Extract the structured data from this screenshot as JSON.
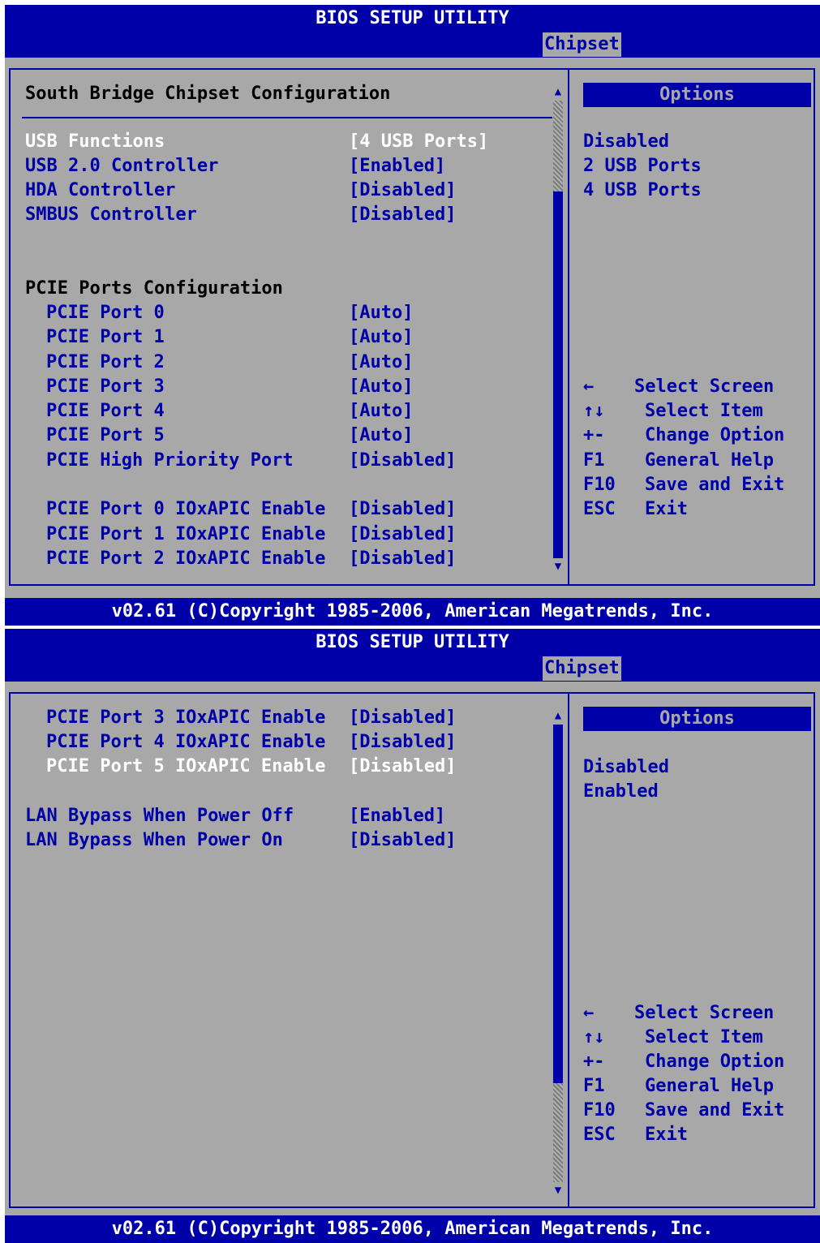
{
  "title": "BIOS SETUP UTILITY",
  "active_tab": "Chipset",
  "footer": "v02.61 (C)Copyright 1985-2006, American Megatrends, Inc.",
  "screen1": {
    "heading": "South Bridge Chipset Configuration",
    "items": [
      {
        "label": "USB Functions",
        "value": "[4 USB Ports]"
      },
      {
        "label": "USB 2.0 Controller",
        "value": "[Enabled]"
      },
      {
        "label": "HDA Controller",
        "value": "[Disabled]"
      },
      {
        "label": "SMBUS Controller",
        "value": "[Disabled]"
      }
    ],
    "pcie_heading": "PCIE Ports Configuration",
    "pcie_items": [
      {
        "label": "PCIE Port 0",
        "value": "[Auto]"
      },
      {
        "label": "PCIE Port 1",
        "value": "[Auto]"
      },
      {
        "label": "PCIE Port 2",
        "value": "[Auto]"
      },
      {
        "label": "PCIE Port 3",
        "value": "[Auto]"
      },
      {
        "label": "PCIE Port 4",
        "value": "[Auto]"
      },
      {
        "label": "PCIE Port 5",
        "value": "[Auto]"
      },
      {
        "label": "PCIE High Priority Port",
        "value": "[Disabled]"
      }
    ],
    "ioapic_items": [
      {
        "label": "PCIE Port 0 IOxAPIC Enable",
        "value": "[Disabled]"
      },
      {
        "label": "PCIE Port 1 IOxAPIC Enable",
        "value": "[Disabled]"
      },
      {
        "label": "PCIE Port 2 IOxAPIC Enable",
        "value": "[Disabled]"
      }
    ],
    "options_title": "Options",
    "options": [
      "Disabled",
      "2 USB Ports",
      "4 USB Ports"
    ],
    "scroll_position": 0.0
  },
  "screen2": {
    "ioapic_items": [
      {
        "label": "PCIE Port 3 IOxAPIC Enable",
        "value": "[Disabled]"
      },
      {
        "label": "PCIE Port 4 IOxAPIC Enable",
        "value": "[Disabled]"
      },
      {
        "label": "PCIE Port 5 IOxAPIC Enable",
        "value": "[Disabled]"
      }
    ],
    "lan_items": [
      {
        "label": "LAN Bypass When Power Off",
        "value": "[Enabled]"
      },
      {
        "label": "LAN Bypass When Power On",
        "value": "[Disabled]"
      }
    ],
    "options_title": "Options",
    "options": [
      "Disabled",
      "Enabled"
    ],
    "scroll_position": 1.0
  },
  "help_keys": [
    {
      "key": "←",
      "desc": "Select Screen"
    },
    {
      "key": "↑↓",
      "desc": "Select Item"
    },
    {
      "key": "+-",
      "desc": "Change Option"
    },
    {
      "key": "F1",
      "desc": "General Help"
    },
    {
      "key": "F10",
      "desc": "Save and Exit"
    },
    {
      "key": "ESC",
      "desc": "Exit"
    }
  ],
  "colors": {
    "background": "#a8a8a8",
    "accent": "#0000a8",
    "selected_text": "#ffffff"
  }
}
